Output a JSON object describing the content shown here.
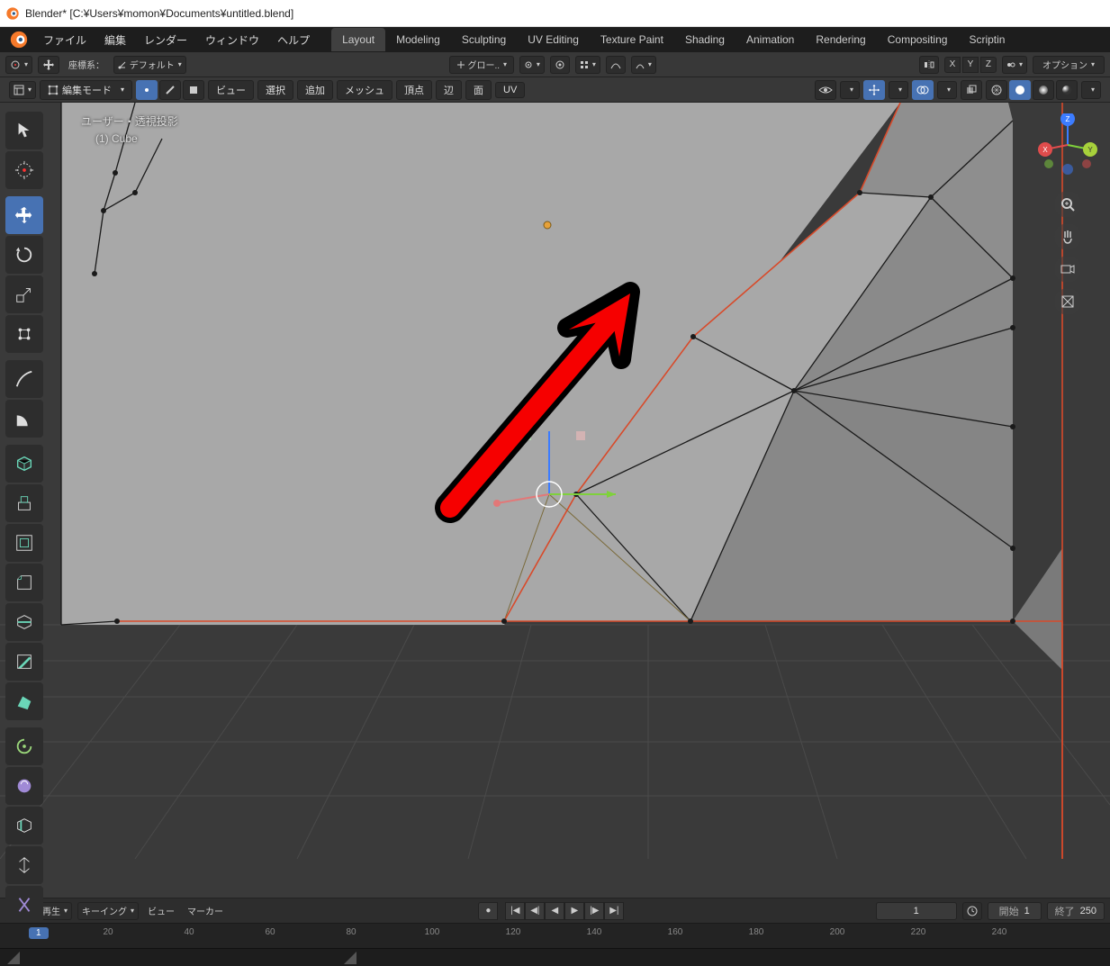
{
  "window": {
    "title": "Blender* [C:¥Users¥momon¥Documents¥untitled.blend]"
  },
  "menubar": {
    "file": "ファイル",
    "edit": "編集",
    "render": "レンダー",
    "window": "ウィンドウ",
    "help": "ヘルプ",
    "tabs": [
      "Layout",
      "Modeling",
      "Sculpting",
      "UV Editing",
      "Texture Paint",
      "Shading",
      "Animation",
      "Rendering",
      "Compositing",
      "Scriptin"
    ],
    "active_tab": 0
  },
  "header": {
    "orientation_label": "座標系：",
    "orientation_value": "デフォルト",
    "snap_mode": "グロー..",
    "axes": [
      "X",
      "Y",
      "Z"
    ],
    "options_label": "オプション"
  },
  "editor": {
    "mode": "編集モード",
    "menus": {
      "view": "ビュー",
      "select": "選択",
      "add": "追加",
      "mesh": "メッシュ",
      "vertex": "頂点",
      "edge": "辺",
      "face": "面",
      "uv": "UV"
    }
  },
  "overlay": {
    "projection": "ユーザー・透視投影",
    "object_name": "(1) Cube"
  },
  "timeline": {
    "playback": "再生",
    "keying": "キーイング",
    "view": "ビュー",
    "marker": "マーカー",
    "current_frame": "1",
    "start_label": "開始",
    "start_value": "1",
    "end_label": "終了",
    "end_value": "250",
    "ticks": [
      20,
      40,
      60,
      80,
      100,
      120,
      140,
      160,
      180,
      200,
      220,
      240
    ]
  },
  "colors": {
    "accent": "#4772b3",
    "select_edge": "#d84a2a",
    "z_axis": "#3c7cff",
    "x_axis": "#e04c4c",
    "y_axis": "#7fd13b"
  }
}
